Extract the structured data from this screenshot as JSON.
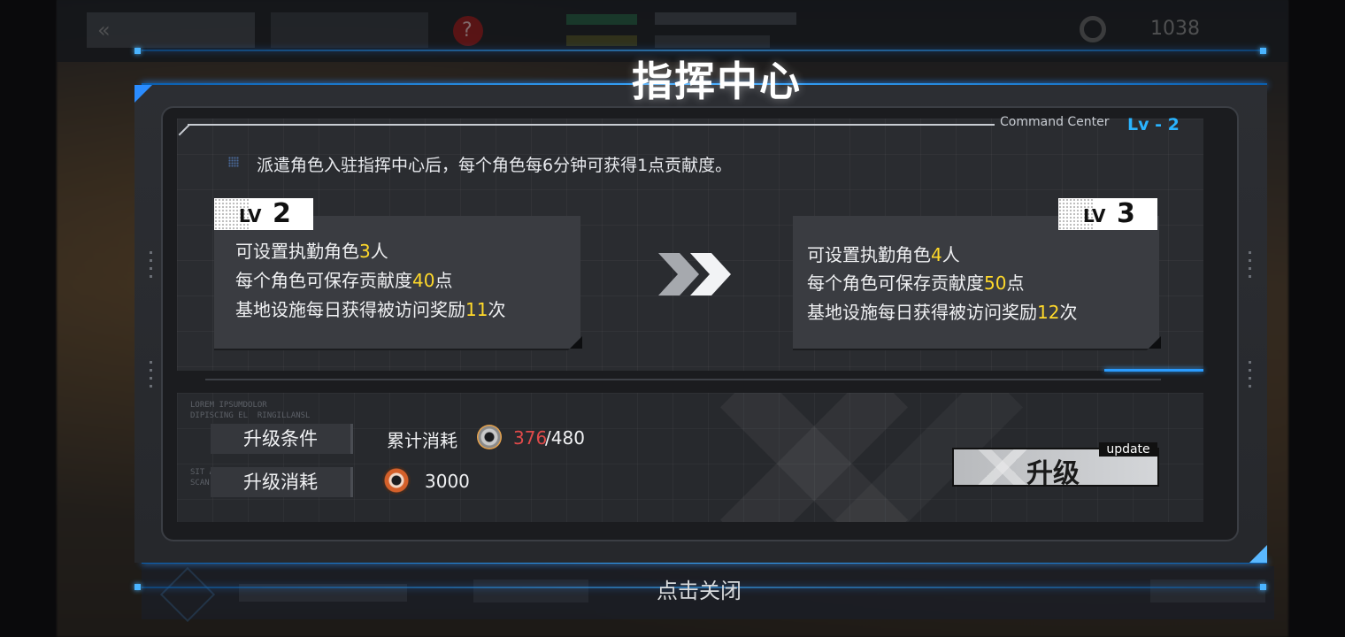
{
  "background": {
    "back_glyph": "«",
    "help_glyph": "?",
    "currency_count": "1038"
  },
  "panel": {
    "title": "指挥中心",
    "subtitle": "Command Center",
    "level_tag": "Lv - 2",
    "description": "派遣角色入驻指挥中心后，每个角色每6分钟可获得1点贡献度。"
  },
  "current_level": {
    "badge_lv": "LV",
    "badge_num": "2",
    "line1_prefix": "可设置执勤角色",
    "line1_value": "3",
    "line1_suffix": "人",
    "line2_prefix": "每个角色可保存贡献度",
    "line2_value": "40",
    "line2_suffix": "点",
    "line3_prefix": "基地设施每日获得被访问奖励",
    "line3_value": "11",
    "line3_suffix": "次"
  },
  "next_level": {
    "badge_lv": "LV",
    "badge_num": "3",
    "line1_prefix": "可设置执勤角色",
    "line1_value": "4",
    "line1_suffix": "人",
    "line2_prefix": "每个角色可保存贡献度",
    "line2_value": "50",
    "line2_suffix": "点",
    "line3_prefix": "基地设施每日获得被访问奖励",
    "line3_value": "12",
    "line3_suffix": "次"
  },
  "requirements": {
    "condition_label": "升级条件",
    "cost_label": "升级消耗",
    "cumulative_label": "累计消耗",
    "cumulative_current": "376",
    "cumulative_max": "/480",
    "coin_cost": "3000",
    "deco_text_1": "LOREM IPSUMDOLOR\nDIPISCING EL  RINGILLANSL",
    "deco_text_2": "SIT AMET, CONSECTETUR\nSCAN SERVI"
  },
  "actions": {
    "upgrade_label": "升级",
    "upgrade_tag": "update",
    "close_hint": "点击关闭"
  },
  "colors": {
    "accent_blue": "#2ab4ff",
    "highlight_yellow": "#ffd92a",
    "insufficient_red": "#e04a4a"
  },
  "icons": [
    "gear-currency-icon",
    "coin-icon",
    "double-chevron-right-icon",
    "dot-grid-icon"
  ]
}
